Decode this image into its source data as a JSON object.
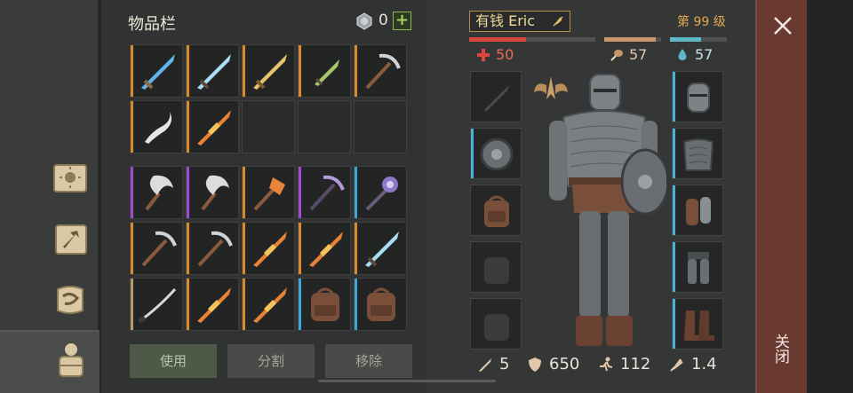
{
  "inventory": {
    "title": "物品栏",
    "gem_count": "0",
    "add_label": "+",
    "use_label": "使用",
    "split_label": "分割",
    "remove_label": "移除",
    "rows_top": [
      [
        "blue-sword-icon",
        "ice-sword-icon",
        "gold-sword-icon",
        "green-dagger-icon",
        "pickaxe-icon"
      ],
      [
        "curved-blade-icon",
        "flame-sword-icon",
        "",
        "",
        ""
      ]
    ],
    "rows_bottom": [
      [
        "sickle-icon",
        "sickle-icon",
        "fire-axe-icon",
        "purple-pickaxe-icon",
        "spiked-mace-icon"
      ],
      [
        "pickaxe-icon",
        "pickaxe-icon",
        "flame-sword-icon",
        "flame-sword-icon",
        "ice-sword-icon"
      ],
      [
        "katana-icon",
        "flame-sword-icon",
        "flame-sword-icon",
        "backpack-icon",
        "backpack-icon"
      ]
    ]
  },
  "character": {
    "name": "有钱 Eric",
    "level": "第 99 级",
    "health": "50",
    "hunger": "57",
    "thirst": "57",
    "attack": "5",
    "armor": "650",
    "speed": "112",
    "weight": "1.4",
    "health_fraction": 0.45,
    "hunger_fraction": 0.9,
    "thirst_fraction": 0.55
  },
  "close": {
    "label": "关闭"
  },
  "colors": {
    "orange_edge": "#d98a2b",
    "purple_edge": "#a24bd0",
    "blue_edge": "#3aa7d8",
    "tan_edge": "#b79a6a",
    "health": "#d8453c",
    "hunger": "#c9956a",
    "thirst": "#5fb8c8"
  }
}
